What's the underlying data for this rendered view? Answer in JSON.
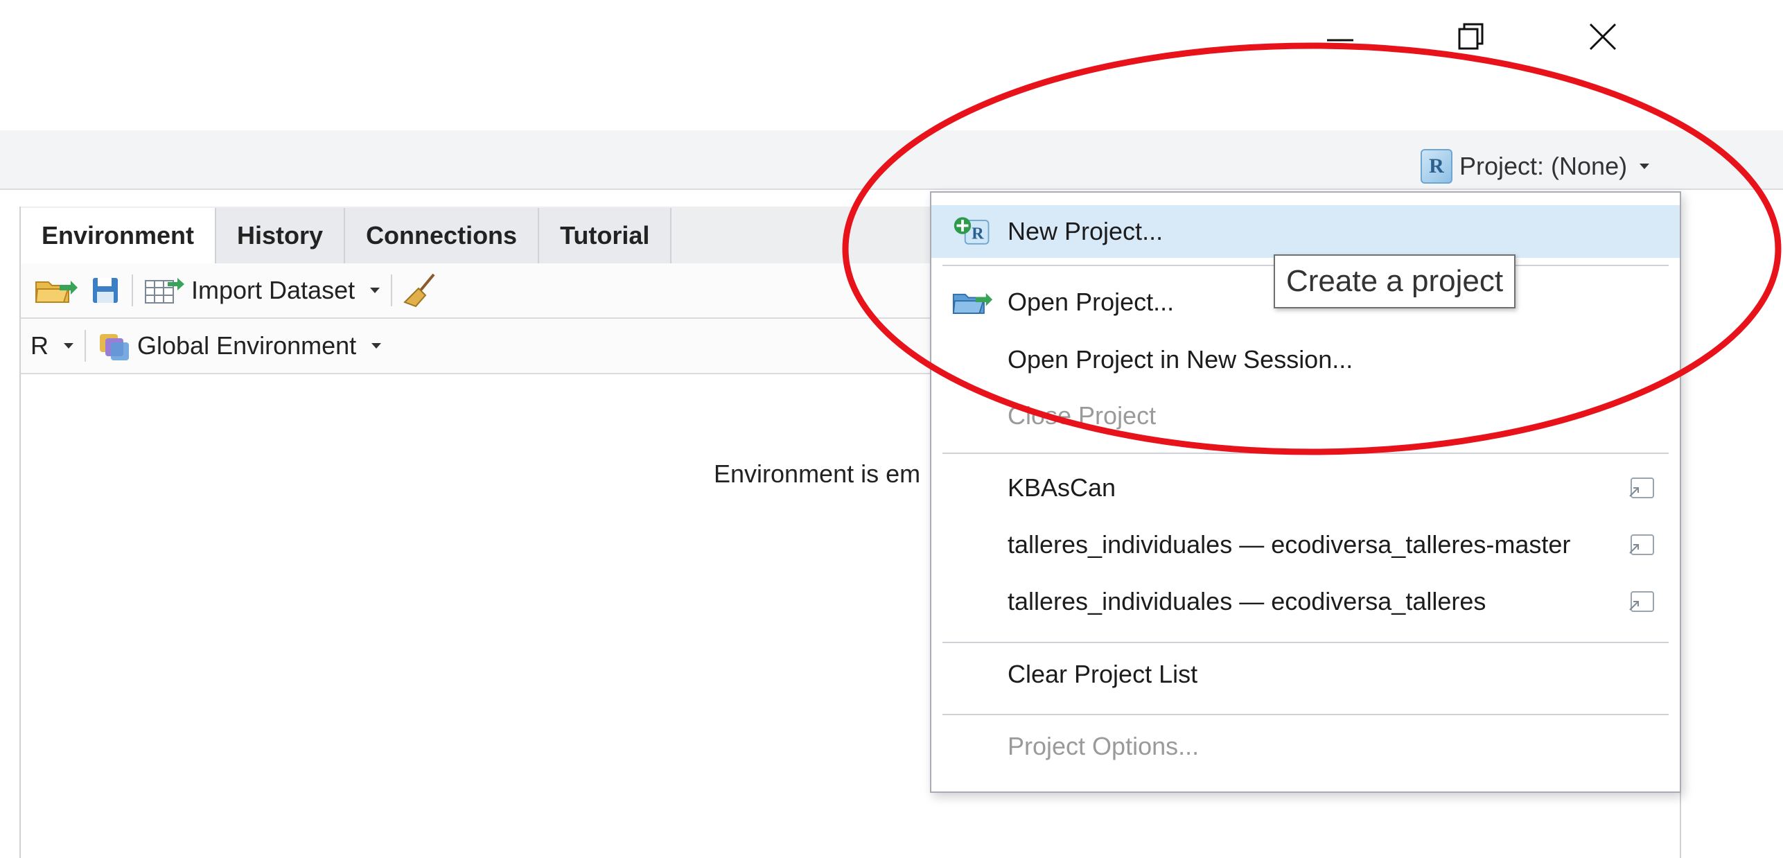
{
  "window_controls": {
    "minimize_icon": "minimize-icon",
    "maximize_icon": "restore-icon",
    "close_icon": "close-icon"
  },
  "toolbar": {
    "project_button_label": "Project: (None)",
    "project_icon_letter": "R"
  },
  "env_pane": {
    "tabs": [
      {
        "label": "Environment",
        "active": true
      },
      {
        "label": "History",
        "active": false
      },
      {
        "label": "Connections",
        "active": false
      },
      {
        "label": "Tutorial",
        "active": false
      }
    ],
    "import_dataset_label": "Import Dataset",
    "language_label": "R",
    "scope_label": "Global Environment",
    "empty_message": "Environment is em"
  },
  "project_menu": {
    "new_project": "New Project...",
    "open_project": "Open Project...",
    "open_project_new_session": "Open Project in New Session...",
    "close_project": "Close Project",
    "recent_projects": [
      "KBAsCan",
      "talleres_individuales — ecodiversa_talleres-master",
      "talleres_individuales — ecodiversa_talleres"
    ],
    "clear_project_list": "Clear Project List",
    "project_options": "Project Options..."
  },
  "tooltip": {
    "text": "Create a project"
  },
  "colors": {
    "highlight": "#d8e9f8",
    "annotation": "#e8121a",
    "disabled_text": "#9a9a9a"
  }
}
